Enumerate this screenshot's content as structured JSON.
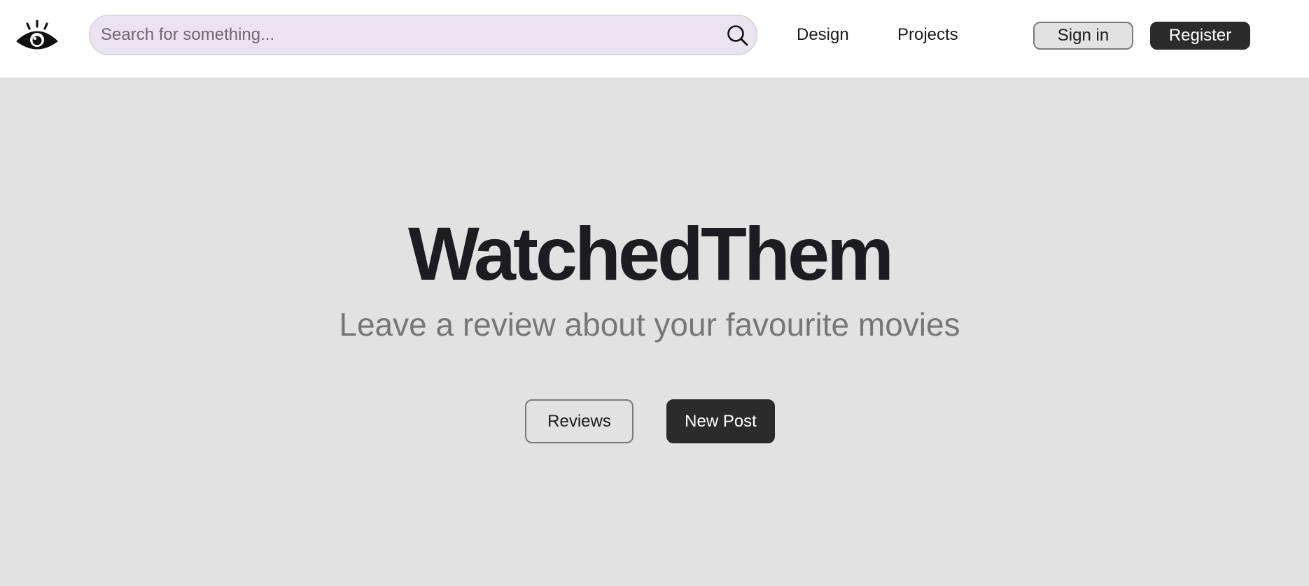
{
  "header": {
    "logo_icon": "eye-icon",
    "search": {
      "placeholder": "Search for something...",
      "value": "",
      "icon": "search-icon"
    },
    "nav": [
      {
        "label": "Design"
      },
      {
        "label": "Projects"
      }
    ],
    "signin_label": "Sign in",
    "register_label": "Register"
  },
  "hero": {
    "title": "WatchedThem",
    "subtitle": "Leave a review about your favourite movies",
    "reviews_label": "Reviews",
    "new_post_label": "New Post"
  },
  "colors": {
    "header_bg": "#ffffff",
    "page_bg": "#e2e2e2",
    "search_bg": "#e9e4ef",
    "dark_button": "#2b2b2b",
    "title_text": "#1c1c21",
    "subtitle_text": "#767676"
  }
}
